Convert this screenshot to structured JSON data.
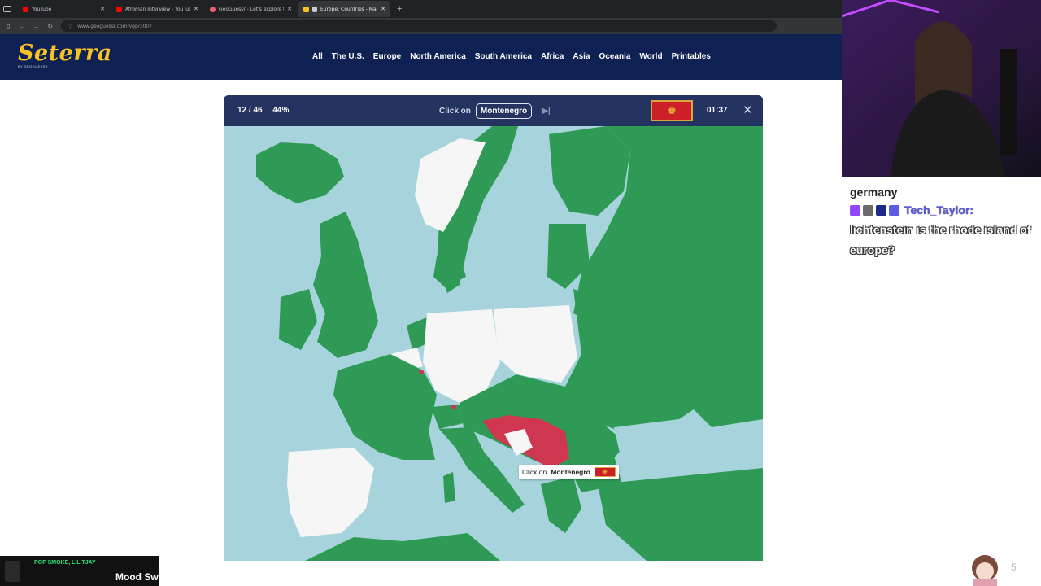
{
  "browser": {
    "tabs": [
      {
        "title": "YouTube",
        "color": "#ff0000",
        "active": false
      },
      {
        "title": "Afroman Interview - YouTube",
        "color": "#ff0000",
        "active": false
      },
      {
        "title": "GeoGuessr - Let's explore the w",
        "color": "#f35b6f",
        "active": false
      },
      {
        "title": "Europe: Countries - Map Q",
        "color": "#f7c325",
        "active": true
      }
    ],
    "url": "www.geoguessr.com/vgp/3007"
  },
  "site": {
    "logo": "Seterra",
    "logo_sub": "BY GEOGUESSR",
    "nav": [
      "All",
      "The U.S.",
      "Europe",
      "North America",
      "South America",
      "Africa",
      "Asia",
      "Oceania",
      "World",
      "Printables"
    ]
  },
  "game": {
    "progress": "12 / 46",
    "percent": "44%",
    "click_on_label": "Click on",
    "target": "Montenegro",
    "timer": "01:37",
    "tooltip_prefix": "Click on",
    "tooltip_target": "Montenegro",
    "colors": {
      "correct": "#2f9a56",
      "pending": "#f6f6f6",
      "wrong": "#cf364f",
      "sea": "#a7d4dc"
    }
  },
  "chat": {
    "prev_message": "germany",
    "username": "Tech_Taylor:",
    "message": "lichtenstein is the rhode island of europe?"
  },
  "music": {
    "artist": "POP SMOKE, LIL TJAY",
    "song": "Mood Sw"
  },
  "corner_number": "5"
}
